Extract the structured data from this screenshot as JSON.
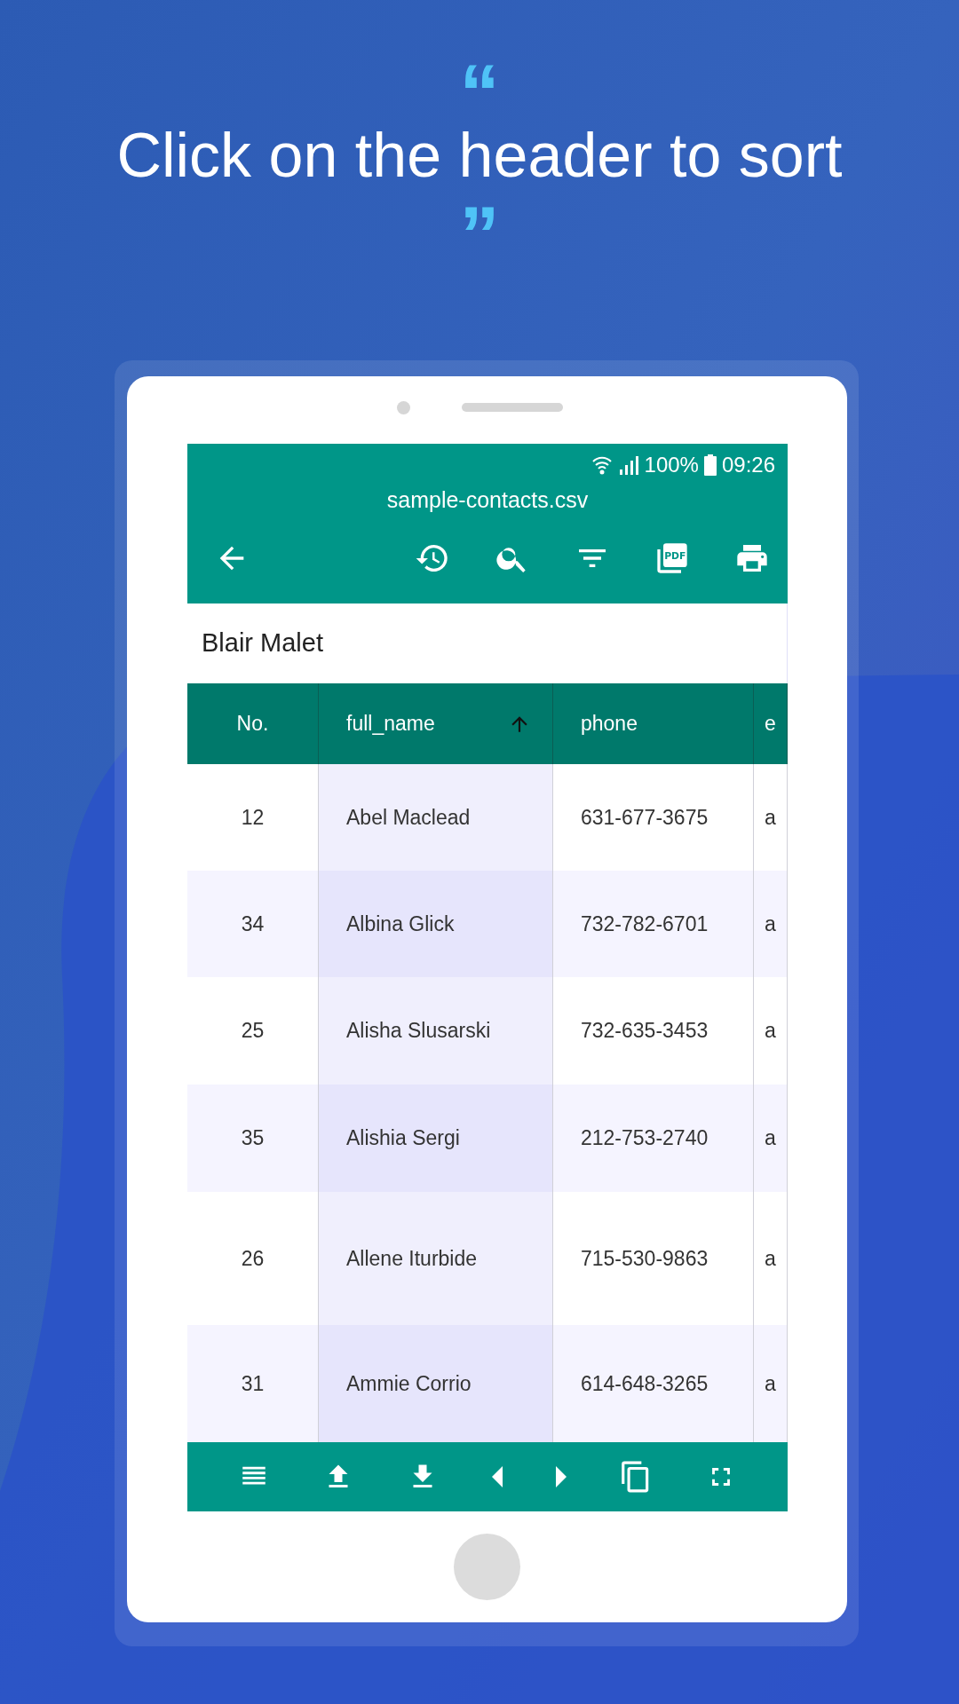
{
  "headline": {
    "open_quote": "“",
    "text": "Click on the header to sort",
    "close_quote": "”"
  },
  "status_bar": {
    "battery": "100%",
    "time": "09:26"
  },
  "app_bar": {
    "title": "sample-contacts.csv",
    "pdf_label": "PDF"
  },
  "filter_label": "Blair Malet",
  "table": {
    "columns": [
      {
        "label": "No.",
        "sorted": false
      },
      {
        "label": "full_name",
        "sorted": true
      },
      {
        "label": "phone",
        "sorted": false
      },
      {
        "label": "e",
        "sorted": false
      }
    ],
    "rows": [
      {
        "cells": [
          "12",
          "Abel Maclead",
          "631-677-3675",
          "a"
        ]
      },
      {
        "cells": [
          "34",
          "Albina Glick",
          "732-782-6701",
          "a"
        ]
      },
      {
        "cells": [
          "25",
          "Alisha Slusarski",
          "732-635-3453",
          "a"
        ]
      },
      {
        "cells": [
          "35",
          "Alishia Sergi",
          "212-753-2740",
          "a"
        ]
      },
      {
        "cells": [
          "26",
          "Allene Iturbide",
          "715-530-9863",
          "a"
        ]
      },
      {
        "cells": [
          "31",
          "Ammie Corrio",
          "614-648-3265",
          "a"
        ]
      }
    ]
  }
}
